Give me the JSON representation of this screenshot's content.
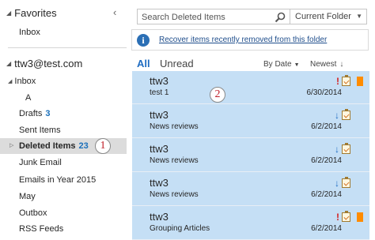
{
  "sidebar": {
    "favorites_header": "Favorites",
    "favorites": [
      {
        "label": "Inbox"
      }
    ],
    "account": "ttw3@test.com",
    "inbox_node": "Inbox",
    "folders": [
      {
        "label": "A",
        "count": ""
      },
      {
        "label": "Drafts",
        "count": "3"
      },
      {
        "label": "Sent Items",
        "count": ""
      },
      {
        "label": "Deleted Items",
        "count": "23"
      },
      {
        "label": "Junk Email",
        "count": ""
      },
      {
        "label": "Emails in Year 2015",
        "count": ""
      },
      {
        "label": "May",
        "count": ""
      },
      {
        "label": "Outbox",
        "count": ""
      },
      {
        "label": "RSS Feeds",
        "count": ""
      }
    ],
    "selected_folder": "Deleted Items",
    "callout": "1"
  },
  "search": {
    "placeholder": "Search Deleted Items",
    "scope": "Current Folder"
  },
  "info_bar": {
    "link": "Recover items recently removed from this folder"
  },
  "filter": {
    "all": "All",
    "unread": "Unread",
    "sort_by": "By Date",
    "order": "Newest"
  },
  "messages": [
    {
      "sender": "ttw3",
      "subject": "test 1",
      "date": "6/30/2014",
      "importance": "high",
      "flagged": true
    },
    {
      "sender": "ttw3",
      "subject": "News reviews",
      "date": "6/2/2014",
      "importance": "low",
      "flagged": false
    },
    {
      "sender": "ttw3",
      "subject": "News reviews",
      "date": "6/2/2014",
      "importance": "low",
      "flagged": false
    },
    {
      "sender": "ttw3",
      "subject": "News reviews",
      "date": "6/2/2014",
      "importance": "low",
      "flagged": false
    },
    {
      "sender": "ttw3",
      "subject": "Grouping Articles",
      "date": "6/2/2014",
      "importance": "high",
      "flagged": true
    }
  ],
  "list_callout": "2",
  "colors": {
    "accent": "#1e6cc2",
    "selected_row": "#c5dff5",
    "flag": "#ff8c00",
    "high_importance": "#d42020",
    "callout_text": "#c0202a"
  }
}
